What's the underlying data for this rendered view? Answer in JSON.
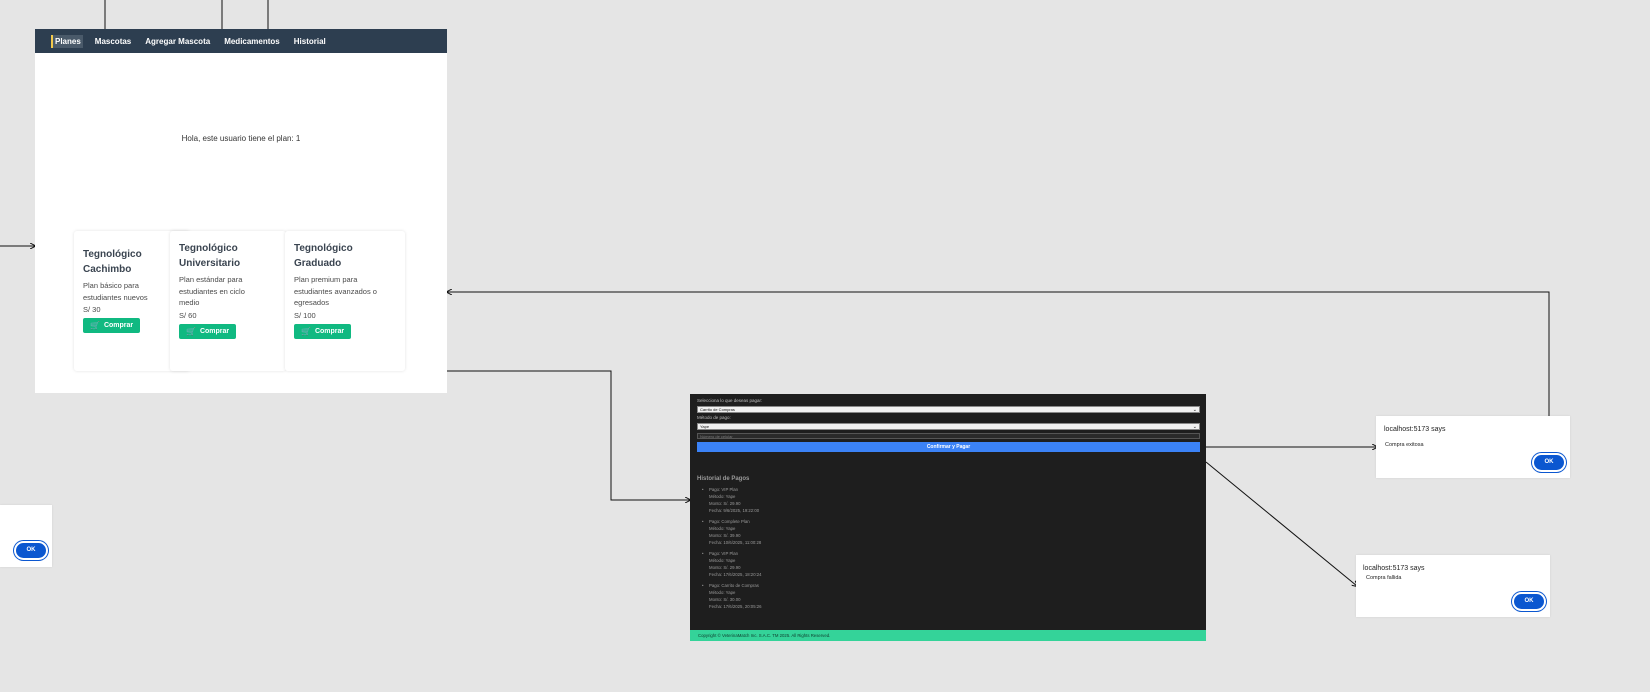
{
  "planes_page": {
    "nav": [
      "Planes",
      "Mascotas",
      "Agregar Mascota",
      "Medicamentos",
      "Historial"
    ],
    "greeting": "Hola, este usuario tiene el plan: 1",
    "plans": [
      {
        "title_1": "Tegnológico",
        "title_2": "Cachimbo",
        "desc": [
          "Plan básico para",
          "estudiantes nuevos"
        ],
        "price": "S/ 30",
        "button": "Comprar"
      },
      {
        "title_1": "Tegnológico",
        "title_2": "Universitario",
        "desc": [
          "Plan estándar para",
          "estudiantes en ciclo",
          "medio"
        ],
        "price": "S/ 60",
        "button": "Comprar"
      },
      {
        "title_1": "Tegnológico",
        "title_2": "Graduado",
        "desc": [
          "Plan premium para",
          "estudiantes avanzados o",
          "egresados"
        ],
        "price": "S/ 100",
        "button": "Comprar"
      }
    ]
  },
  "payment_page": {
    "select_label": "Selecciona lo que deseas pagar:",
    "select_value": "Carrito de Compras",
    "method_label": "Método de pago:",
    "method_value": "Yape",
    "number_placeholder": "Número de celular",
    "submit": "Confirmar y Pagar",
    "history_title": "Historial de Pagos",
    "history": [
      {
        "lines": [
          "Pago: VIP Plan",
          "Método: Yape",
          "Monto: S/. 29.90",
          "Fecha: 9/6/2025, 19:22:00"
        ]
      },
      {
        "lines": [
          "Pago: Complete Plan",
          "Método: Yape",
          "Monto: S/. 39.90",
          "Fecha: 10/6/2025, 11:00:28"
        ]
      },
      {
        "lines": [
          "Pago: VIP Plan",
          "Método: Yape",
          "Monto: S/. 29.90",
          "Fecha: 17/6/2025, 18:20:24"
        ]
      },
      {
        "lines": [
          "Pago: Carrito de Compras",
          "Método: Yape",
          "Monto: S/. 30.00",
          "Fecha: 17/6/2025, 20:05:26"
        ]
      }
    ],
    "footer": "Copyright © VeterinaMatch Inc. S.A.C. TM 2025. All Rights Reserved."
  },
  "dialog_success": {
    "title": "localhost:5173 says",
    "message": "Compra exitosa",
    "ok": "OK"
  },
  "dialog_fail": {
    "title": "localhost:5173 says",
    "message": "Compra fallida",
    "ok": "OK"
  },
  "dialog_partial": {
    "ok": "OK"
  },
  "colors": {
    "nav_bg": "#2d3e50",
    "buy_button": "#10b981",
    "pay_button": "#3b82f6",
    "footer": "#34d399",
    "dialog_ok": "#0b57d0"
  }
}
